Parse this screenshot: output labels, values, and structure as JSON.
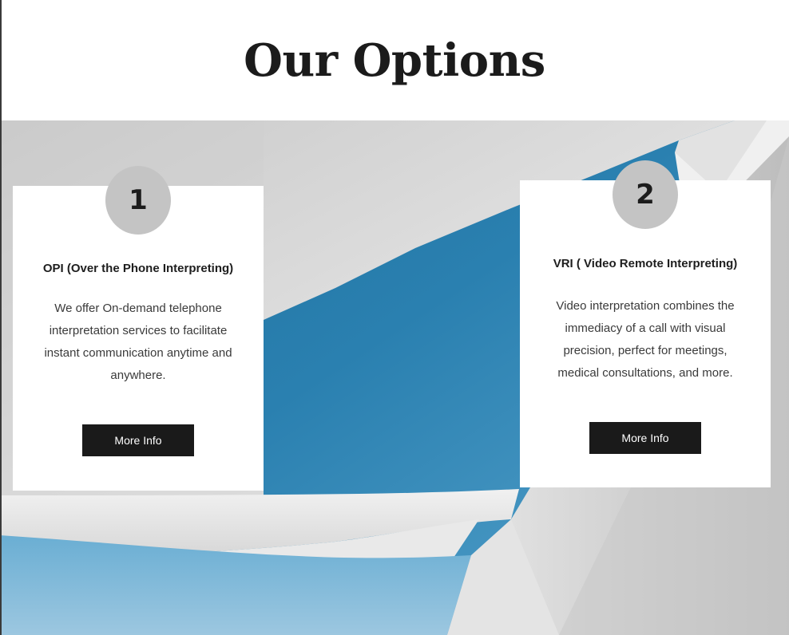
{
  "page": {
    "heading": "Our Options"
  },
  "options": [
    {
      "number": "1",
      "title": "OPI (Over the Phone Interpreting)",
      "description": "We offer On-demand telephone interpretation services to facilitate instant communication anytime and anywhere.",
      "button_label": "More Info"
    },
    {
      "number": "2",
      "title": "VRI ( Video Remote Interpreting)",
      "description": "Video interpretation combines the immediacy of a call with visual precision, perfect for meetings, medical consultations, and more.",
      "button_label": "More Info"
    }
  ],
  "colors": {
    "heading_text": "#1b1b1b",
    "background_sky": "#2f86b5",
    "background_architecture": "#dcdcdc",
    "badge": "#c4c4c4",
    "button": "#1a1a1a",
    "card": "#ffffff"
  }
}
